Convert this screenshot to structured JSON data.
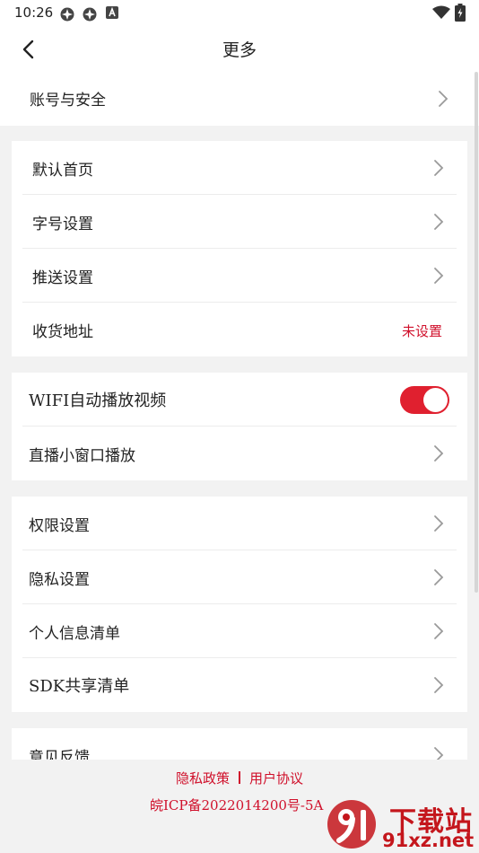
{
  "status_bar": {
    "time": "10:26"
  },
  "header": {
    "title": "更多"
  },
  "account": {
    "label": "账号与安全"
  },
  "group1": [
    {
      "label": "默认首页"
    },
    {
      "label": "字号设置"
    },
    {
      "label": "推送设置"
    },
    {
      "label": "收货地址",
      "value": "未设置"
    }
  ],
  "group2": [
    {
      "label": "WIFI自动播放视频",
      "toggle_on": true
    },
    {
      "label": "直播小窗口播放"
    }
  ],
  "group3": [
    {
      "label": "权限设置"
    },
    {
      "label": "隐私设置"
    },
    {
      "label": "个人信息清单"
    },
    {
      "label": "SDK共享清单"
    }
  ],
  "group4": [
    {
      "label": "意见反馈"
    }
  ],
  "footer": {
    "privacy_policy": "隐私政策",
    "user_agreement": "用户协议",
    "icp": "皖ICP备2022014200号-5A"
  },
  "watermark": {
    "text": "下载站",
    "url": "91xz.net"
  },
  "colors": {
    "accent": "#d0102b",
    "toggle_on": "#e0202f",
    "background": "#f2f2f2"
  }
}
